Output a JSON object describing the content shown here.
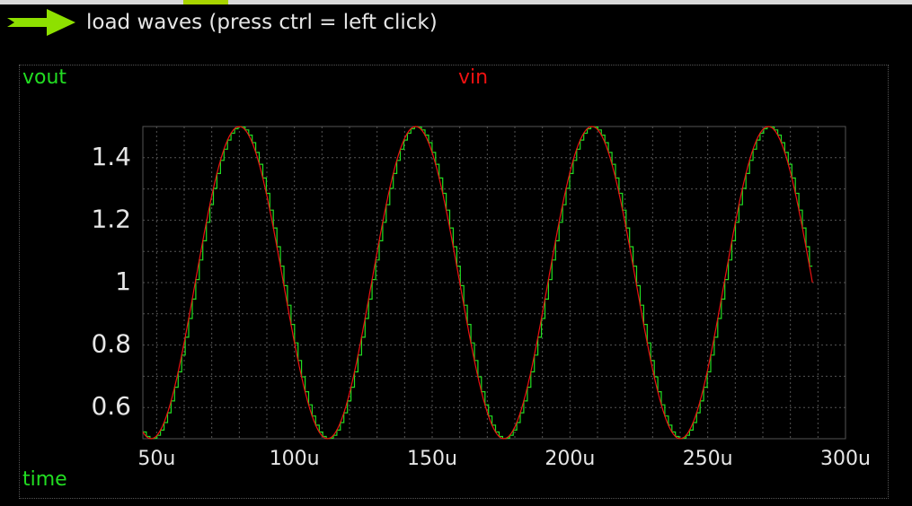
{
  "toolbar": {
    "load_label": "load waves (press ctrl = left click)",
    "arrow_icon": "arrow-right-icon",
    "arrow_color": "#8ee000"
  },
  "chart_data": {
    "type": "line",
    "title": "",
    "xlabel": "time",
    "ylabel": "",
    "x_unit": "u",
    "xlim": [
      45,
      300
    ],
    "ylim": [
      0.5,
      1.5
    ],
    "xticks": [
      "50u",
      "100u",
      "150u",
      "200u",
      "250u",
      "300u"
    ],
    "yticks": [
      "0.6",
      "0.8",
      "1",
      "1.2",
      "1.4"
    ],
    "grid": true,
    "series": [
      {
        "name": "vout",
        "color": "#22dd22",
        "style": "step",
        "description_x": [
          45,
          50,
          79.5,
          112,
          144,
          176,
          208,
          240,
          272,
          288
        ],
        "values_x": [
          45,
          50,
          80,
          112,
          144,
          176,
          208,
          240,
          272,
          288
        ],
        "values": [
          0.53,
          0.5,
          1.5,
          0.5,
          1.5,
          0.5,
          1.5,
          0.5,
          1.5,
          1.0
        ]
      },
      {
        "name": "vin",
        "color": "#ee1111",
        "style": "line",
        "values_x": [
          45,
          50,
          80,
          112,
          144,
          176,
          208,
          240,
          272,
          288
        ],
        "values": [
          0.53,
          0.5,
          1.5,
          0.5,
          1.5,
          0.5,
          1.5,
          0.5,
          1.5,
          1.0
        ]
      }
    ]
  }
}
